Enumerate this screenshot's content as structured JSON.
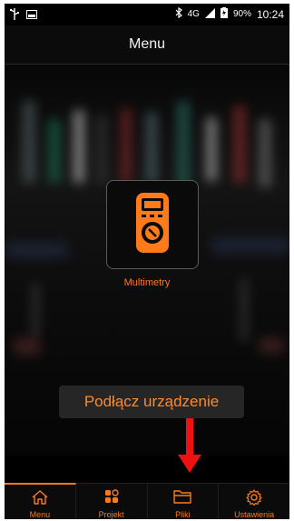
{
  "status_bar": {
    "time": "10:24",
    "battery": "90%",
    "network": "4G",
    "icons": [
      "usb-icon",
      "image-icon",
      "bluetooth-icon",
      "signal-icon",
      "battery-icon"
    ]
  },
  "app_bar": {
    "title": "Menu"
  },
  "tiles": [
    {
      "label": "Multimetry",
      "icon": "multimeter-icon"
    }
  ],
  "toast": {
    "text": "Podłącz urządzenie"
  },
  "annotation": {
    "icon": "red-down-arrow",
    "color": "#ee1111"
  },
  "bottom_nav": [
    {
      "label": "Menu",
      "icon": "home-icon",
      "active": true
    },
    {
      "label": "Projekt",
      "icon": "grid-icon",
      "active": false
    },
    {
      "label": "Pliki",
      "icon": "folder-icon",
      "active": false
    },
    {
      "label": "Ustawienia",
      "icon": "gear-icon",
      "active": false
    }
  ],
  "colors": {
    "accent": "#ff7a1a",
    "background": "#000000"
  }
}
